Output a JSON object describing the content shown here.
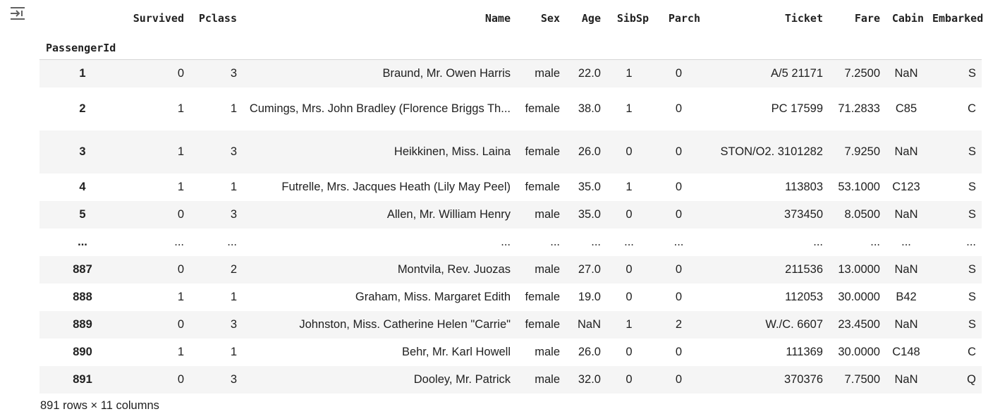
{
  "output": {
    "toggle_icon": "output-collapse-icon"
  },
  "dataframe": {
    "columns": [
      "Survived",
      "Pclass",
      "Name",
      "Sex",
      "Age",
      "SibSp",
      "Parch",
      "Ticket",
      "Fare",
      "Cabin",
      "Embarked"
    ],
    "index_name": "PassengerId",
    "rows": [
      {
        "index": "1",
        "cells": [
          "0",
          "3",
          "Braund, Mr. Owen Harris",
          "male",
          "22.0",
          "1",
          "0",
          "A/5 21171",
          "7.2500",
          "NaN",
          "S"
        ]
      },
      {
        "index": "2",
        "cells": [
          "1",
          "1",
          "Cumings, Mrs. John Bradley (Florence Briggs Th...",
          "female",
          "38.0",
          "1",
          "0",
          "PC 17599",
          "71.2833",
          "C85",
          "C"
        ]
      },
      {
        "index": "3",
        "cells": [
          "1",
          "3",
          "Heikkinen, Miss. Laina",
          "female",
          "26.0",
          "0",
          "0",
          "STON/O2. 3101282",
          "7.9250",
          "NaN",
          "S"
        ]
      },
      {
        "index": "4",
        "cells": [
          "1",
          "1",
          "Futrelle, Mrs. Jacques Heath (Lily May Peel)",
          "female",
          "35.0",
          "1",
          "0",
          "113803",
          "53.1000",
          "C123",
          "S"
        ]
      },
      {
        "index": "5",
        "cells": [
          "0",
          "3",
          "Allen, Mr. William Henry",
          "male",
          "35.0",
          "0",
          "0",
          "373450",
          "8.0500",
          "NaN",
          "S"
        ]
      },
      {
        "index": "...",
        "cells": [
          "...",
          "...",
          "...",
          "...",
          "...",
          "...",
          "...",
          "...",
          "...",
          "...",
          "..."
        ]
      },
      {
        "index": "887",
        "cells": [
          "0",
          "2",
          "Montvila, Rev. Juozas",
          "male",
          "27.0",
          "0",
          "0",
          "211536",
          "13.0000",
          "NaN",
          "S"
        ]
      },
      {
        "index": "888",
        "cells": [
          "1",
          "1",
          "Graham, Miss. Margaret Edith",
          "female",
          "19.0",
          "0",
          "0",
          "112053",
          "30.0000",
          "B42",
          "S"
        ]
      },
      {
        "index": "889",
        "cells": [
          "0",
          "3",
          "Johnston, Miss. Catherine Helen \"Carrie\"",
          "female",
          "NaN",
          "1",
          "2",
          "W./C. 6607",
          "23.4500",
          "NaN",
          "S"
        ]
      },
      {
        "index": "890",
        "cells": [
          "1",
          "1",
          "Behr, Mr. Karl Howell",
          "male",
          "26.0",
          "0",
          "0",
          "111369",
          "30.0000",
          "C148",
          "C"
        ]
      },
      {
        "index": "891",
        "cells": [
          "0",
          "3",
          "Dooley, Mr. Patrick",
          "male",
          "32.0",
          "0",
          "0",
          "370376",
          "7.7500",
          "NaN",
          "Q"
        ]
      }
    ],
    "shape_caption": "891 rows × 11 columns"
  }
}
